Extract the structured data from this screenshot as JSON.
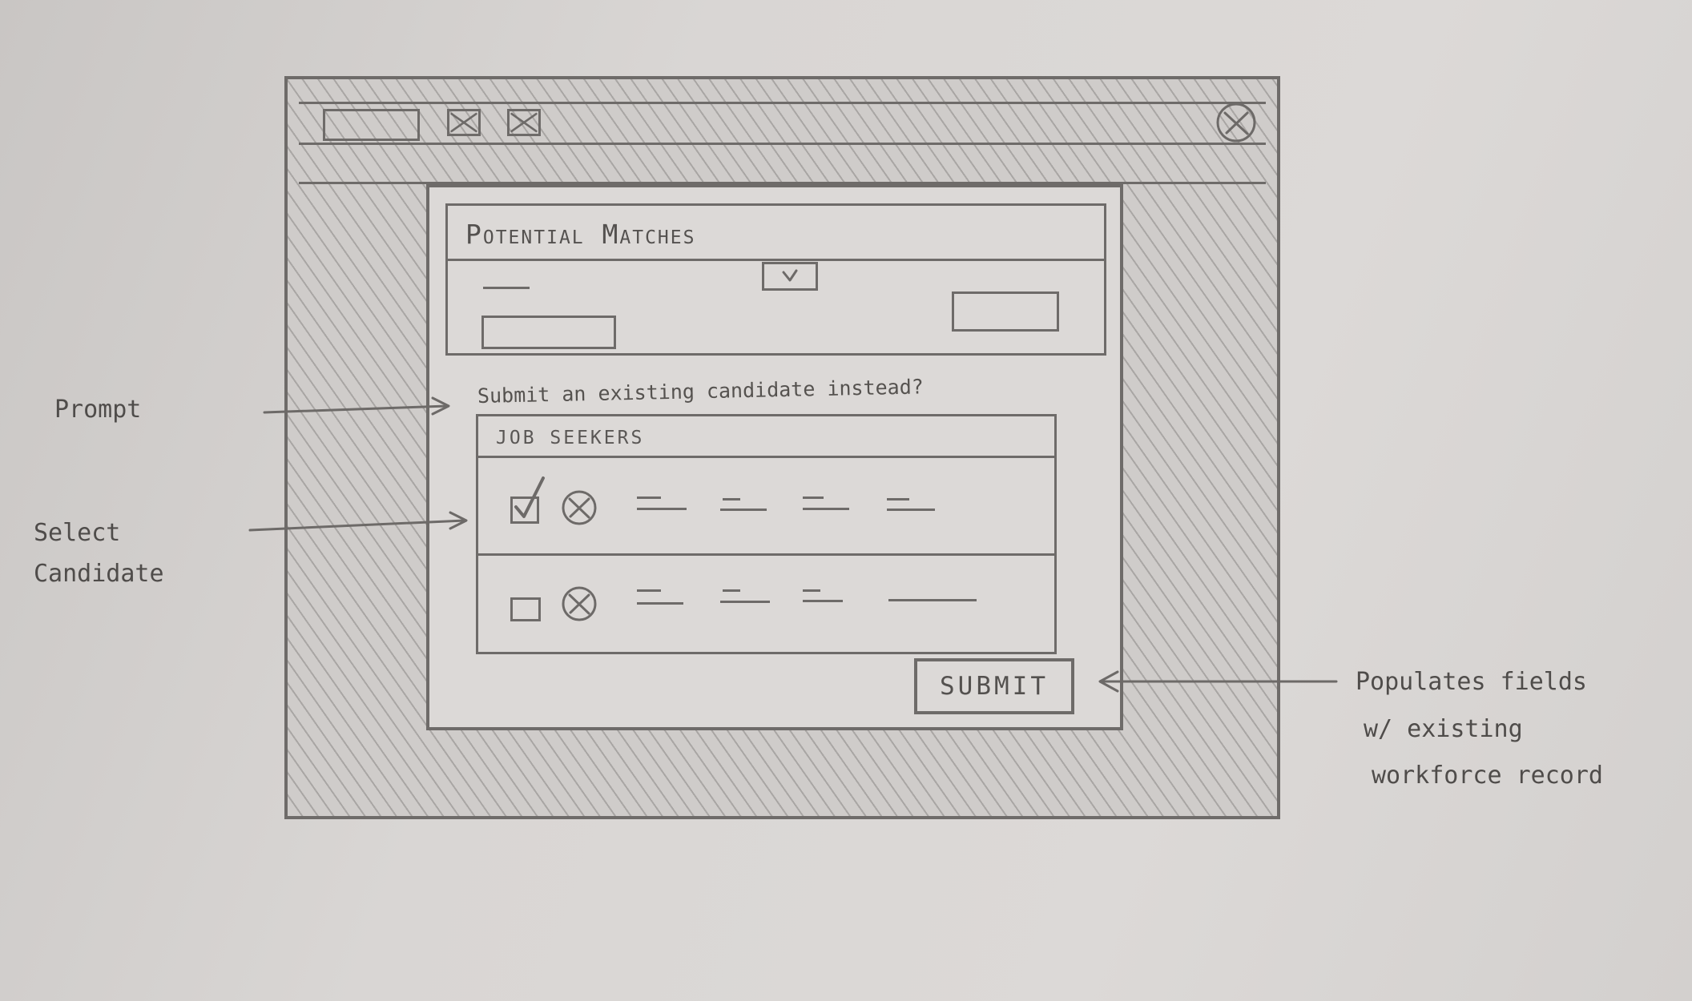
{
  "dialog": {
    "title": "Potential Matches",
    "prompt": "Submit an existing candidate instead?",
    "table_header": "JOB SEEKERS",
    "rows": [
      {
        "selected": true
      },
      {
        "selected": false
      }
    ],
    "submit_label": "SUBMIT"
  },
  "annotations": {
    "prompt": "Prompt",
    "select_candidate": [
      "Select",
      "Candidate"
    ],
    "submit_note": [
      "Populates fields",
      "w/ existing",
      "workforce record"
    ]
  },
  "colors": {
    "paper": "#d8d5d3",
    "pencil": "#6e6b69"
  },
  "icons": {
    "window_buttons": [
      "close-box-icon",
      "close-box-icon",
      "close-circle-icon"
    ],
    "row_icons": [
      "checkbox-icon",
      "remove-circle-icon"
    ]
  }
}
